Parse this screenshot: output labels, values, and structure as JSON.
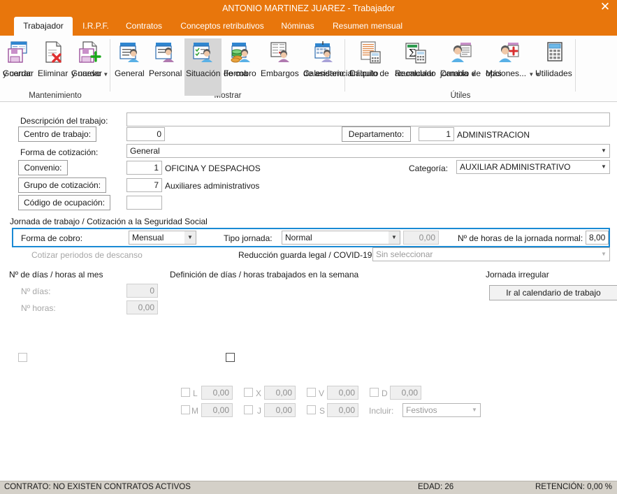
{
  "window": {
    "title": "ANTONIO MARTINEZ JUAREZ - Trabajador",
    "close_icon": "✕",
    "accent_color": "#e8760c",
    "highlight_color": "#1a8ad4"
  },
  "tabs": [
    {
      "label": "Trabajador",
      "active": true
    },
    {
      "label": "I.R.P.F.",
      "active": false
    },
    {
      "label": "Contratos",
      "active": false
    },
    {
      "label": "Conceptos retributivos",
      "active": false
    },
    {
      "label": "Nóminas",
      "active": false
    },
    {
      "label": "Resumen mensual",
      "active": false
    }
  ],
  "ribbon": {
    "groups": [
      {
        "name": "Mantenimiento"
      },
      {
        "name": "Mostrar"
      },
      {
        "name": "Útiles"
      }
    ],
    "buttons": [
      {
        "line1": "Guardar",
        "line2": "y cerrar",
        "icon": "save-close-icon",
        "caret": false,
        "selected": false
      },
      {
        "line1": "Eliminar",
        "line2": "",
        "icon": "delete-document-icon",
        "caret": false,
        "selected": false
      },
      {
        "line1": "Guardar",
        "line2": "y nuevo",
        "icon": "save-new-icon",
        "caret": true,
        "selected": false
      },
      {
        "line1": "General",
        "line2": "",
        "icon": "general-person-icon",
        "caret": false,
        "selected": false
      },
      {
        "line1": "Personal",
        "line2": "",
        "icon": "personal-person-icon",
        "caret": false,
        "selected": false
      },
      {
        "line1": "Situación",
        "line2": "",
        "icon": "situacion-person-icon",
        "caret": false,
        "selected": true
      },
      {
        "line1": "Forma",
        "line2": "de cobro",
        "icon": "money-person-icon",
        "caret": false,
        "selected": false
      },
      {
        "line1": "Embargos",
        "line2": "",
        "icon": "embargos-person-icon",
        "caret": false,
        "selected": false
      },
      {
        "line1": "Calendario",
        "line2": "de asistencia",
        "icon": "calendar-person-icon",
        "caret": false,
        "selected": false
      },
      {
        "line1": "Cálculo de",
        "line2": "finiquito",
        "icon": "calc-document-icon",
        "caret": false,
        "selected": false
      },
      {
        "line1": "Recalcular",
        "line2": "acumulado",
        "icon": "sigma-calc-icon",
        "caret": false,
        "selected": false
      },
      {
        "line1": "Cambio de",
        "line2": "jornada",
        "icon": "change-shift-icon",
        "caret": true,
        "selected": false
      },
      {
        "line1": "Más",
        "line2": "opciones...",
        "icon": "more-options-icon",
        "caret": true,
        "selected": false
      },
      {
        "line1": "Utilidades",
        "line2": "",
        "icon": "calculator-icon",
        "caret": true,
        "selected": false
      }
    ]
  },
  "form": {
    "descripcion_label": "Descripción del trabajo:",
    "descripcion_value": "",
    "centro_label": "Centro de trabajo:",
    "centro_value": "0",
    "departamento_label": "Departamento:",
    "departamento_value": "1",
    "departamento_text": "ADMINISTRACION",
    "forma_cotizacion_label": "Forma de cotización:",
    "forma_cotizacion_value": "General",
    "convenio_label": "Convenio:",
    "convenio_value": "1",
    "convenio_text": "OFICINA Y DESPACHOS",
    "categoria_label": "Categoría:",
    "categoria_value": "AUXILIAR ADMINISTRATIVO",
    "grupo_label": "Grupo de cotización:",
    "grupo_value": "7",
    "grupo_text": "Auxiliares administrativos",
    "codigo_label": "Código de ocupación:",
    "codigo_value": ""
  },
  "jornada": {
    "group_title": "Jornada de trabajo / Cotización a la Seguridad Social",
    "forma_cobro_label": "Forma de cobro:",
    "forma_cobro_value": "Mensual",
    "tipo_jornada_label": "Tipo jornada:",
    "tipo_jornada_value": "Normal",
    "tipo_jornada_num": "0,00",
    "horas_normal_label": "Nº de horas de la jornada normal:",
    "horas_normal_value": "8,00",
    "cotizar_descanso_label": "Cotizar periodos de descanso",
    "cotizar_descanso_checked": false,
    "reduccion_label": "Reducción guarda legal / COVID-19",
    "reduccion_checked": false,
    "reduccion_combo_value": "Sin seleccionar"
  },
  "mes": {
    "section_title": "Nº de días / horas al mes",
    "dias_label": "Nº días:",
    "dias_value": "0",
    "horas_label": "Nº horas:",
    "horas_value": "0,00"
  },
  "semana": {
    "section_title": "Definición de días / horas trabajados en la semana",
    "days": [
      {
        "code": "L",
        "value": "0,00",
        "checked": false
      },
      {
        "code": "M",
        "value": "0,00",
        "checked": false
      },
      {
        "code": "X",
        "value": "0,00",
        "checked": false
      },
      {
        "code": "J",
        "value": "0,00",
        "checked": false
      },
      {
        "code": "V",
        "value": "0,00",
        "checked": false
      },
      {
        "code": "S",
        "value": "0,00",
        "checked": false
      },
      {
        "code": "D",
        "value": "0,00",
        "checked": false
      }
    ],
    "incluir_label": "Incluir:",
    "incluir_value": "Festivos"
  },
  "irregular": {
    "section_title": "Jornada irregular",
    "button_label": "Ir al calendario de trabajo"
  },
  "status": {
    "contrato": "CONTRATO: NO EXISTEN CONTRATOS ACTIVOS",
    "edad": "EDAD: 26",
    "retencion": "RETENCIÓN: 0,00 %"
  }
}
